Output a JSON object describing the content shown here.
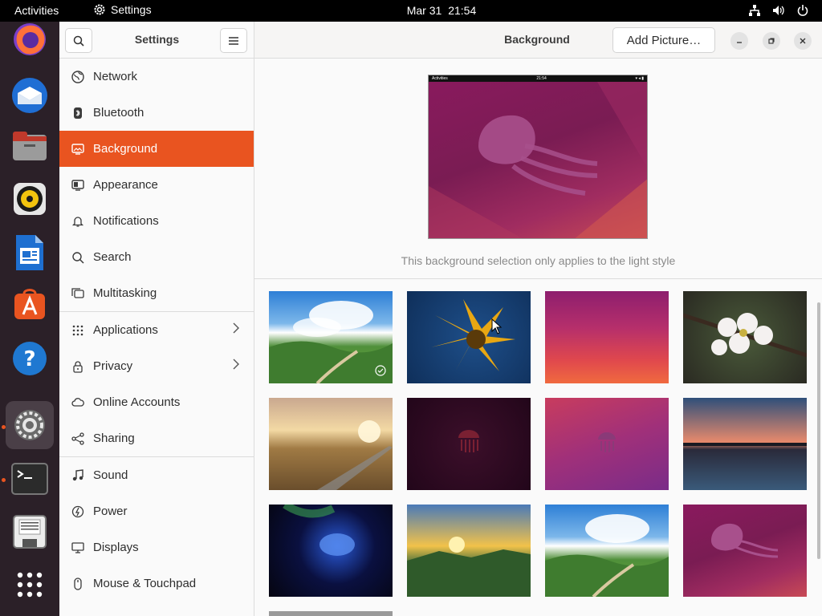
{
  "topbar": {
    "activities": "Activities",
    "app_name": "Settings",
    "date": "Mar 31",
    "time": "21:54"
  },
  "dock": {
    "items": [
      "firefox",
      "thunderbird",
      "files",
      "rhythmbox",
      "libreoffice-writer",
      "ubuntu-software",
      "help",
      "settings",
      "terminal",
      "disk-image",
      "show-applications"
    ]
  },
  "sidebar": {
    "title": "Settings",
    "items": [
      {
        "label": "Network",
        "icon": "network-icon"
      },
      {
        "label": "Bluetooth",
        "icon": "bluetooth-icon"
      },
      {
        "label": "Background",
        "icon": "background-icon"
      },
      {
        "label": "Appearance",
        "icon": "appearance-icon"
      },
      {
        "label": "Notifications",
        "icon": "bell-icon"
      },
      {
        "label": "Search",
        "icon": "search-icon"
      },
      {
        "label": "Multitasking",
        "icon": "multitasking-icon"
      },
      {
        "label": "Applications",
        "icon": "apps-grid-icon"
      },
      {
        "label": "Privacy",
        "icon": "lock-icon"
      },
      {
        "label": "Online Accounts",
        "icon": "cloud-icon"
      },
      {
        "label": "Sharing",
        "icon": "share-icon"
      },
      {
        "label": "Sound",
        "icon": "music-note-icon"
      },
      {
        "label": "Power",
        "icon": "power-icon"
      },
      {
        "label": "Displays",
        "icon": "display-icon"
      },
      {
        "label": "Mouse & Touchpad",
        "icon": "mouse-icon"
      }
    ],
    "selected": "Background"
  },
  "main": {
    "title": "Background",
    "add_button": "Add Picture…",
    "preview_bar_left": "Activities",
    "preview_bar_time": "21:54",
    "note": "This background selection only applies to the light style"
  },
  "colors": {
    "accent": "#e95420",
    "dock_bg": "#2b2028"
  }
}
